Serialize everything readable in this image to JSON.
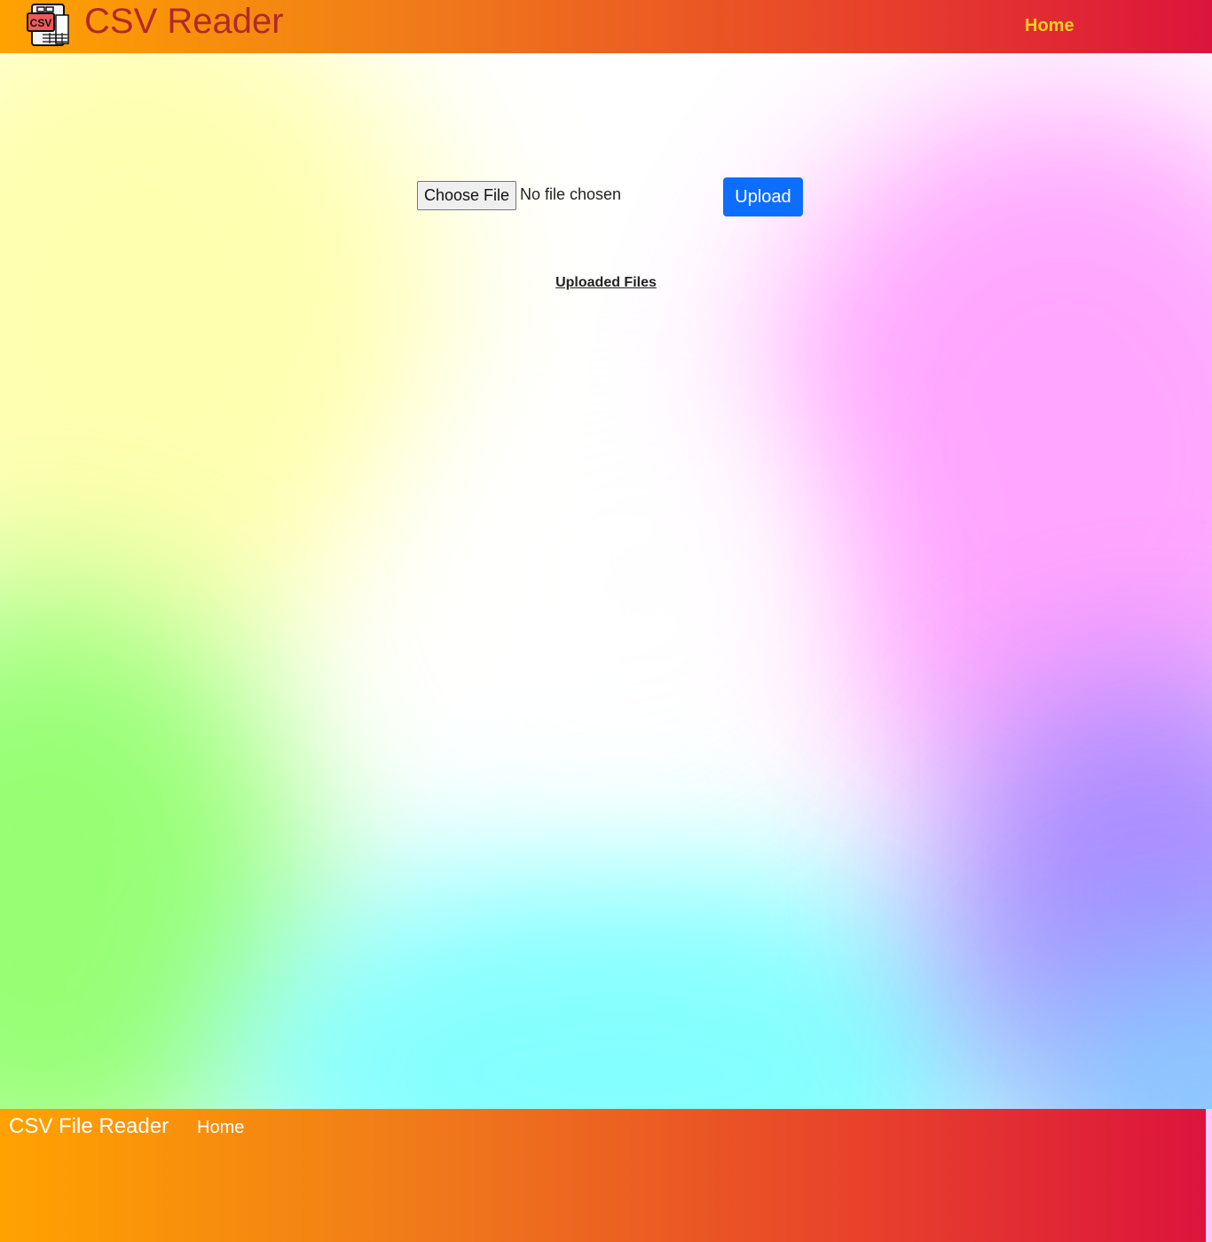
{
  "header": {
    "brand": "CSV Reader",
    "logo_icon": "csv-file-icon",
    "logo_text": "CSV",
    "nav": {
      "home_label": "Home"
    }
  },
  "upload_form": {
    "choose_label": "Choose File",
    "file_status": "No file chosen",
    "upload_label": "Upload"
  },
  "uploaded_section": {
    "title": "Uploaded Files"
  },
  "footer": {
    "brand": "CSV File Reader",
    "home_label": "Home"
  },
  "colors": {
    "header_gradient_start": "#ffa200",
    "header_gradient_end": "#dc143c",
    "brand_text": "#b02a2a",
    "nav_home": "#f8d21c",
    "upload_button": "#0d6efd"
  }
}
